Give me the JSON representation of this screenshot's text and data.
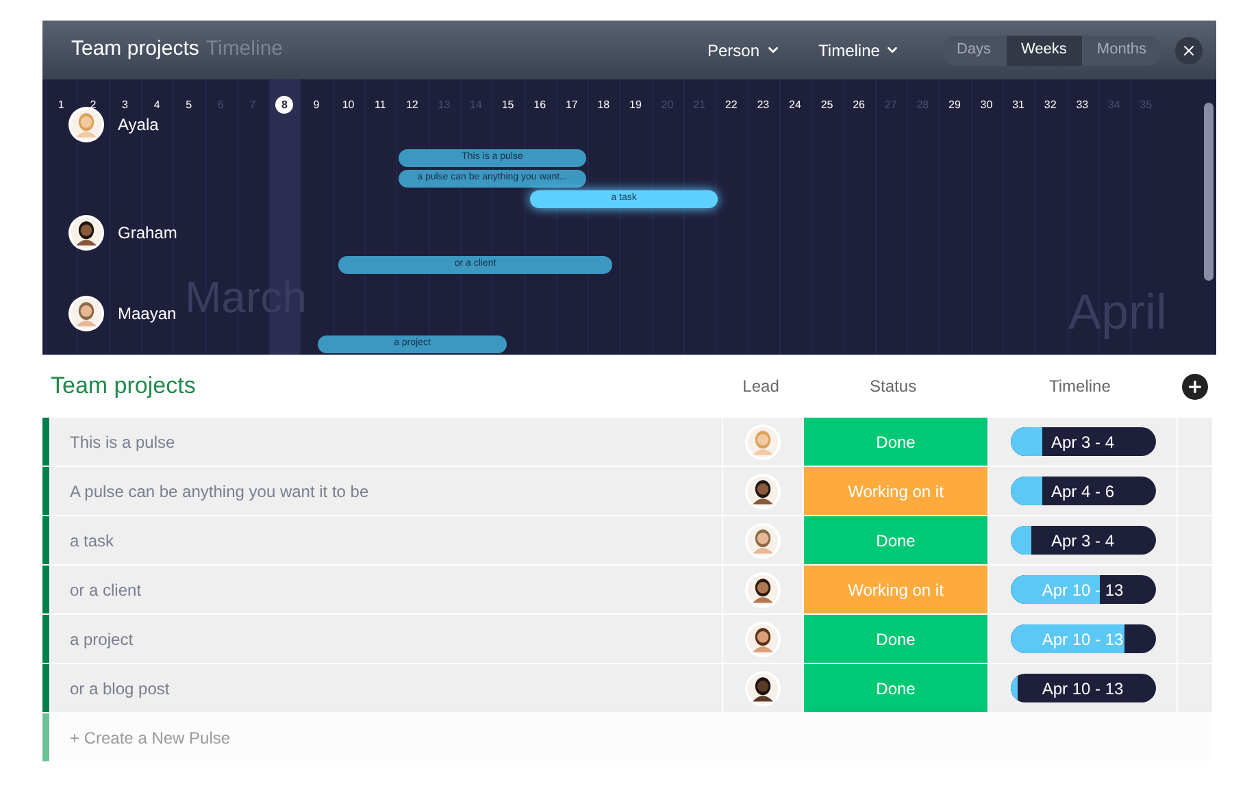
{
  "header": {
    "title": "Team projects",
    "subtitle": "Timeline",
    "filters": [
      {
        "label": "Person"
      },
      {
        "label": "Timeline"
      }
    ],
    "scale_tabs": [
      {
        "label": "Days",
        "selected": false
      },
      {
        "label": "Weeks",
        "selected": true
      },
      {
        "label": "Months",
        "selected": false
      }
    ]
  },
  "timeline": {
    "days": [
      {
        "label": "1",
        "weekend": false,
        "today": false
      },
      {
        "label": "2",
        "weekend": false,
        "today": false
      },
      {
        "label": "3",
        "weekend": false,
        "today": false
      },
      {
        "label": "4",
        "weekend": false,
        "today": false
      },
      {
        "label": "5",
        "weekend": false,
        "today": false
      },
      {
        "label": "6",
        "weekend": true,
        "today": false
      },
      {
        "label": "7",
        "weekend": true,
        "today": false
      },
      {
        "label": "8",
        "weekend": false,
        "today": true
      },
      {
        "label": "9",
        "weekend": false,
        "today": false
      },
      {
        "label": "10",
        "weekend": false,
        "today": false
      },
      {
        "label": "11",
        "weekend": false,
        "today": false
      },
      {
        "label": "12",
        "weekend": false,
        "today": false
      },
      {
        "label": "13",
        "weekend": true,
        "today": false
      },
      {
        "label": "14",
        "weekend": true,
        "today": false
      },
      {
        "label": "15",
        "weekend": false,
        "today": false
      },
      {
        "label": "16",
        "weekend": false,
        "today": false
      },
      {
        "label": "17",
        "weekend": false,
        "today": false
      },
      {
        "label": "18",
        "weekend": false,
        "today": false
      },
      {
        "label": "19",
        "weekend": false,
        "today": false
      },
      {
        "label": "20",
        "weekend": true,
        "today": false
      },
      {
        "label": "21",
        "weekend": true,
        "today": false
      },
      {
        "label": "22",
        "weekend": false,
        "today": false
      },
      {
        "label": "23",
        "weekend": false,
        "today": false
      },
      {
        "label": "24",
        "weekend": false,
        "today": false
      },
      {
        "label": "25",
        "weekend": false,
        "today": false
      },
      {
        "label": "26",
        "weekend": false,
        "today": false
      },
      {
        "label": "27",
        "weekend": true,
        "today": false
      },
      {
        "label": "28",
        "weekend": true,
        "today": false
      },
      {
        "label": "29",
        "weekend": false,
        "today": false
      },
      {
        "label": "30",
        "weekend": false,
        "today": false
      },
      {
        "label": "31",
        "weekend": false,
        "today": false
      },
      {
        "label": "32",
        "weekend": false,
        "today": false
      },
      {
        "label": "33",
        "weekend": false,
        "today": false
      },
      {
        "label": "34",
        "weekend": true,
        "today": false
      },
      {
        "label": "35",
        "weekend": true,
        "today": false
      }
    ],
    "months": [
      "March",
      "April"
    ],
    "people": [
      {
        "name": "Ayala"
      },
      {
        "name": "Graham"
      },
      {
        "name": "Maayan"
      }
    ],
    "bars": [
      {
        "label": "This is a pulse",
        "selected": false
      },
      {
        "label": "a pulse can be anything you want...",
        "selected": false
      },
      {
        "label": "a task",
        "selected": true
      },
      {
        "label": "or a client",
        "selected": false
      },
      {
        "label": "a project",
        "selected": false
      }
    ]
  },
  "table": {
    "title": "Team projects",
    "columns": [
      "Lead",
      "Status",
      "Timeline"
    ],
    "rows": [
      {
        "name": "This is a pulse",
        "status": "Done",
        "color": "#00c875",
        "timeline": "Apr 3 - 4",
        "level": 0.22
      },
      {
        "name": "A pulse can be anything you want it to be",
        "status": "Working on it",
        "color": "#fdab3d",
        "timeline": "Apr 4 - 6",
        "level": 0.22
      },
      {
        "name": "a task",
        "status": "Done",
        "color": "#00c875",
        "timeline": "Apr 3 - 4",
        "level": 0.15
      },
      {
        "name": "or a client",
        "status": "Working on it",
        "color": "#fdab3d",
        "timeline": "Apr 10 - 13",
        "level": 0.62
      },
      {
        "name": "a project",
        "status": "Done",
        "color": "#00c875",
        "timeline": "Apr 10 - 13",
        "level": 0.79
      },
      {
        "name": "or a blog post",
        "status": "Done",
        "color": "#00c875",
        "timeline": "Apr 10 - 13",
        "level": 0.05
      }
    ],
    "new_row": "+ Create a New Pulse"
  }
}
